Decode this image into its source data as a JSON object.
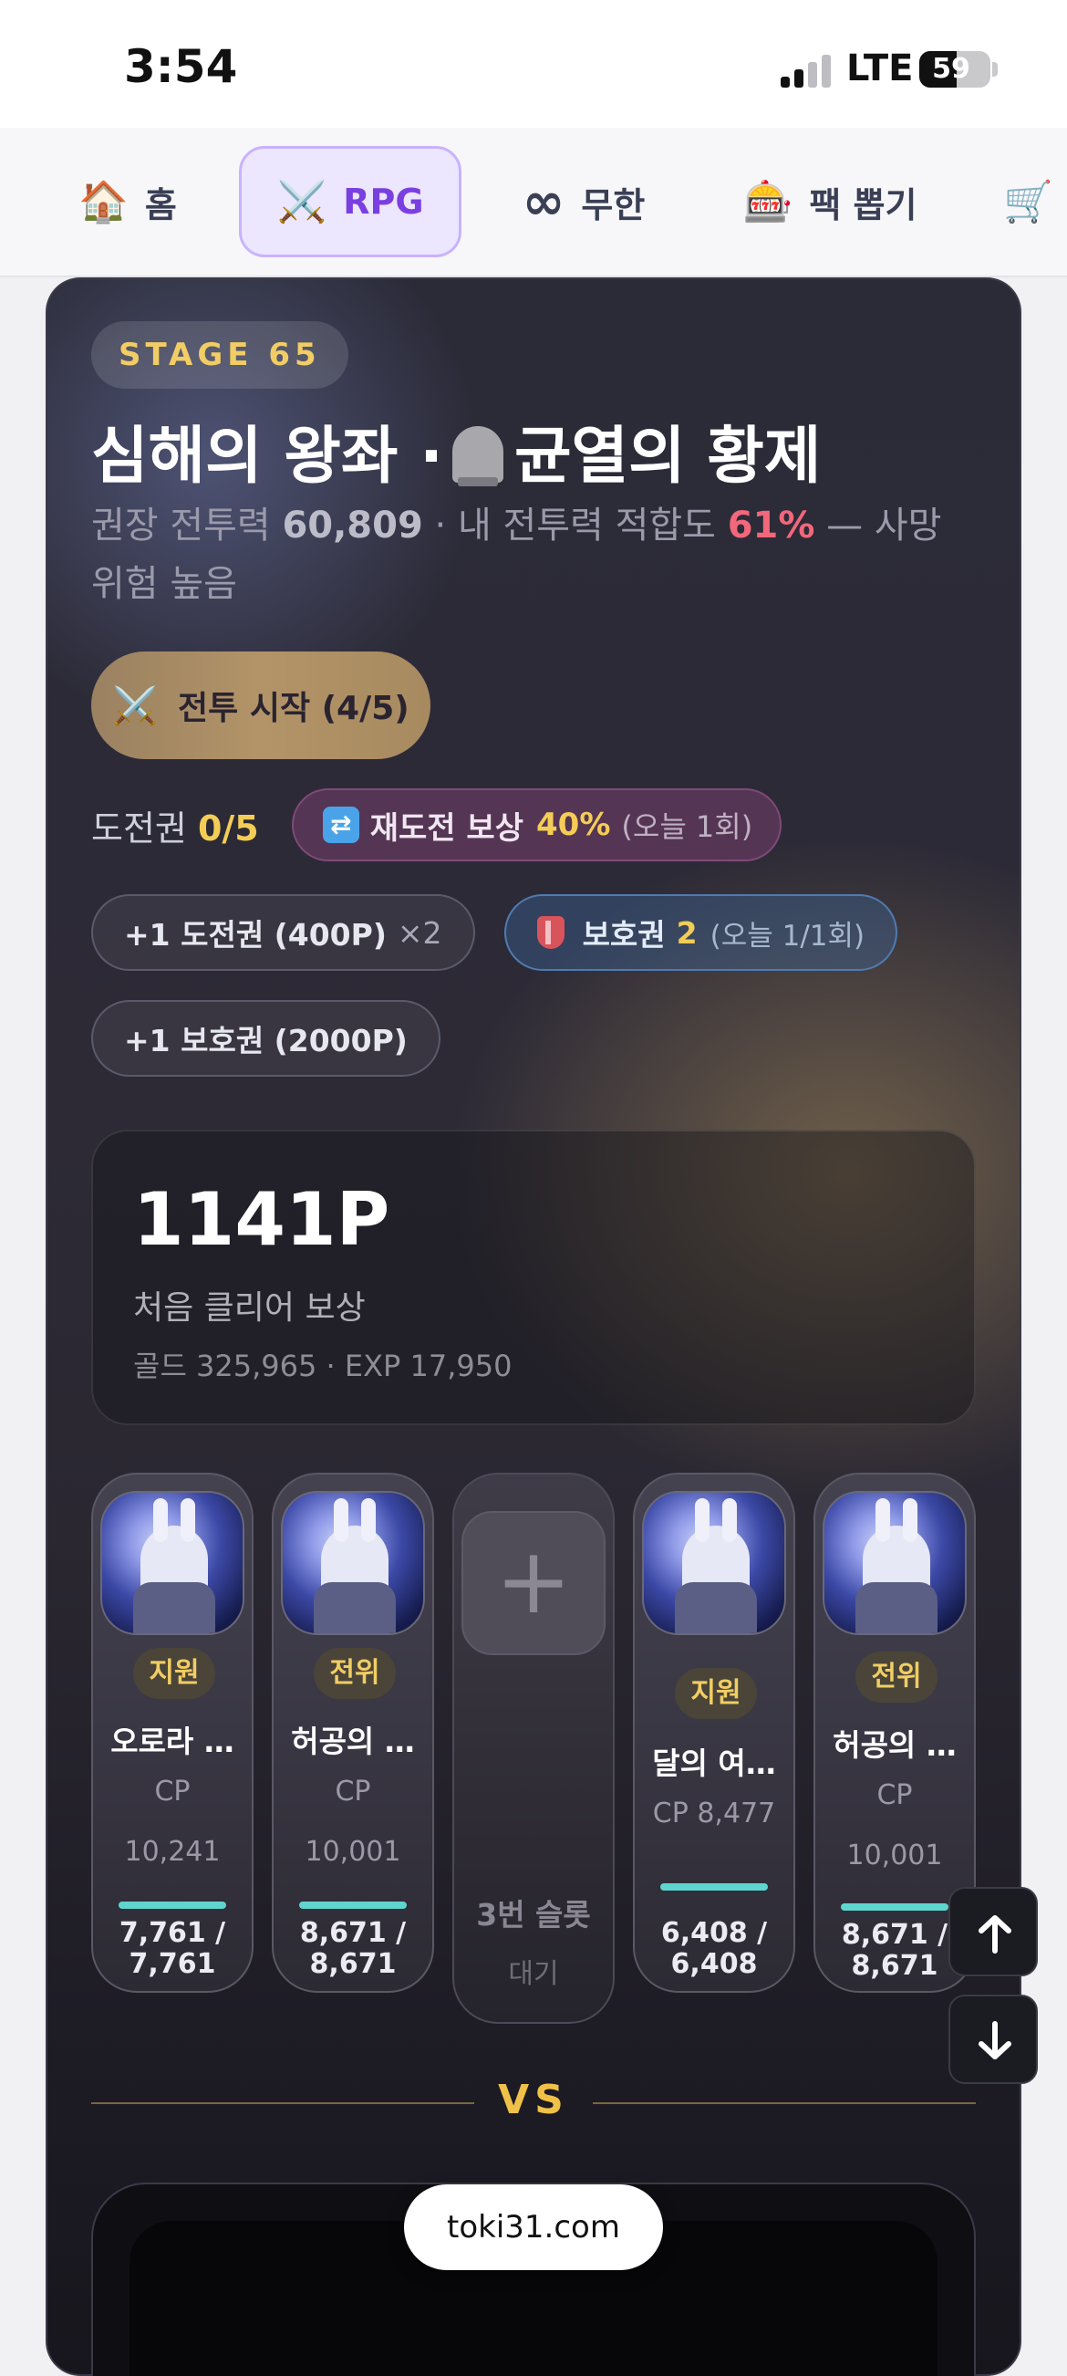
{
  "status_bar": {
    "time": "3:54",
    "network": "LTE",
    "battery": "59",
    "battery_level": 0.59
  },
  "nav": {
    "tabs": [
      {
        "icon": "house-icon",
        "glyph": "🏠",
        "label": "홈",
        "active": false
      },
      {
        "icon": "crossed-swords-icon",
        "glyph": "⚔️",
        "label": "RPG",
        "active": true
      },
      {
        "icon": "infinity-icon",
        "glyph": "∞",
        "label": "무한",
        "active": false
      },
      {
        "icon": "slot-machine-icon",
        "glyph": "🎰",
        "label": "팩 뽑기",
        "active": false
      },
      {
        "icon": "cart-icon",
        "glyph": "🛒",
        "label": "",
        "active": false
      }
    ]
  },
  "stage": {
    "badge": "STAGE 65",
    "title_prefix": "심해의 왕좌 ·",
    "title_icon": "tombstone-icon",
    "title_suffix": "균열의 황제",
    "sub_1": "권장 전투력",
    "sub_power": "60,809",
    "sub_2": "· 내 전투력 적합도",
    "sub_pct": "61%",
    "sub_3": "— 사망 위험 높음"
  },
  "battle": {
    "start_icon": "crossed-swords-icon",
    "start_label": "전투 시작 (4/5)"
  },
  "tickets": {
    "label": "도전권",
    "value": "0/5",
    "retry_icon": "repeat-icon",
    "retry_label": "재도전 보상",
    "retry_pct": "40%",
    "retry_note": "(오늘 1회)"
  },
  "buy": {
    "ticket_label": "+1 도전권 (400P)",
    "ticket_mult": "×2",
    "shield_icon": "shield-icon",
    "shield_label": "보호권",
    "shield_count": "2",
    "shield_note": "(오늘 1/1회)",
    "shield_buy_label": "+1 보호권 (2000P)"
  },
  "reward": {
    "amount": "1141P",
    "label": "처음 클리어 보상",
    "detail": "골드 325,965 · EXP 17,950"
  },
  "party": [
    {
      "role": "지원",
      "name": "오로라 …",
      "cp_label": "CP",
      "cp": "10,241",
      "hp": "7,761 /",
      "hp_max": "7,761",
      "hp_fraction": 1.0
    },
    {
      "role": "전위",
      "name": "허공의 …",
      "cp_label": "CP",
      "cp": "10,001",
      "hp": "8,671 /",
      "hp_max": "8,671",
      "hp_fraction": 1.0
    },
    {
      "empty": true,
      "slot_label": "3번 슬롯",
      "slot_status": "대기"
    },
    {
      "role": "지원",
      "name": "달의 여…",
      "cp_label": "CP 8,477",
      "cp": "",
      "hp": "6,408 /",
      "hp_max": "6,408",
      "hp_fraction": 1.0
    },
    {
      "role": "전위",
      "name": "허공의 …",
      "cp_label": "CP",
      "cp": "10,001",
      "hp": "8,671 /",
      "hp_max": "8,671",
      "hp_fraction": 1.0
    }
  ],
  "vs_label": "VS",
  "scroll_buttons": {
    "up_icon": "arrow-up-icon",
    "down_icon": "arrow-down-icon"
  },
  "url": "toki31.com"
}
